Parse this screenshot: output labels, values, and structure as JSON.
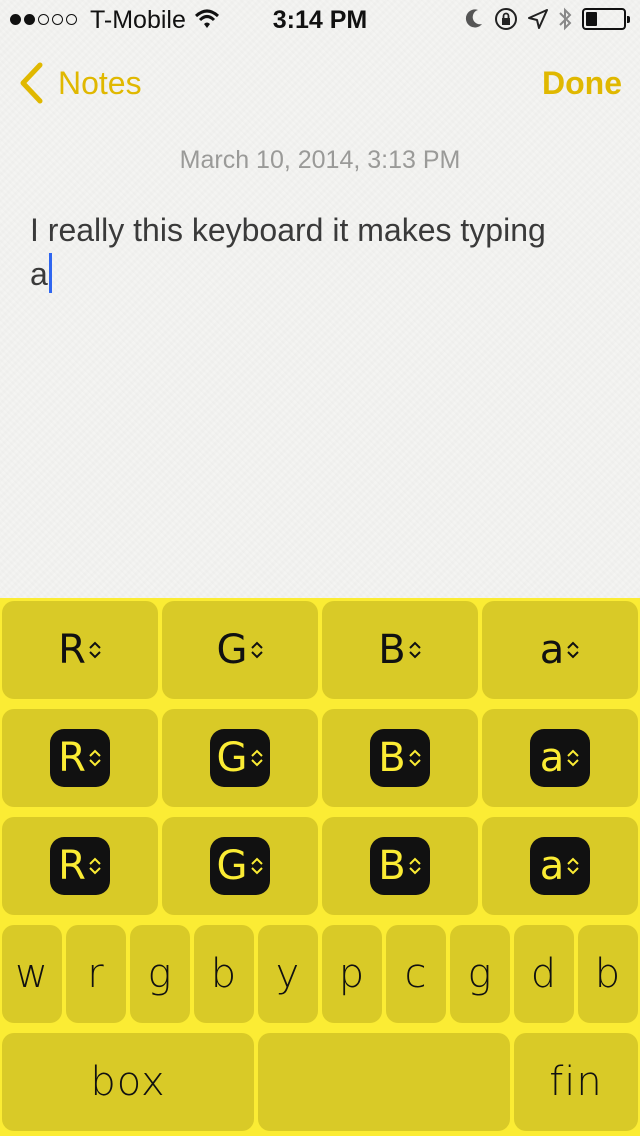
{
  "status_bar": {
    "carrier": "T-Mobile",
    "time": "3:14 PM",
    "signal_bars_filled": 2,
    "signal_bars_total": 5,
    "battery_level": 0.3,
    "icons": [
      "wifi-icon",
      "moon-icon",
      "orientation-lock-icon",
      "location-icon",
      "bluetooth-icon",
      "battery-icon"
    ]
  },
  "nav": {
    "back_label": "Notes",
    "done_label": "Done",
    "accent_color": "#e0b800"
  },
  "note": {
    "date": "March 10, 2014, 3:13 PM",
    "line1": "I really this keyboard it makes typing",
    "line2": "a"
  },
  "keyboard": {
    "background_color": "#fbec34",
    "key_color": "#d9ca27",
    "color_rows": [
      {
        "style": "plain",
        "keys": [
          "R",
          "G",
          "B",
          "a"
        ]
      },
      {
        "style": "pill",
        "keys": [
          "R",
          "G",
          "B",
          "a"
        ]
      },
      {
        "style": "pill",
        "keys": [
          "R",
          "G",
          "B",
          "a"
        ]
      }
    ],
    "letter_row": [
      "w",
      "r",
      "g",
      "b",
      "y",
      "p",
      "c",
      "g",
      "d",
      "b"
    ],
    "bottom_row": {
      "left": "box",
      "middle": "",
      "right": "fin"
    }
  }
}
